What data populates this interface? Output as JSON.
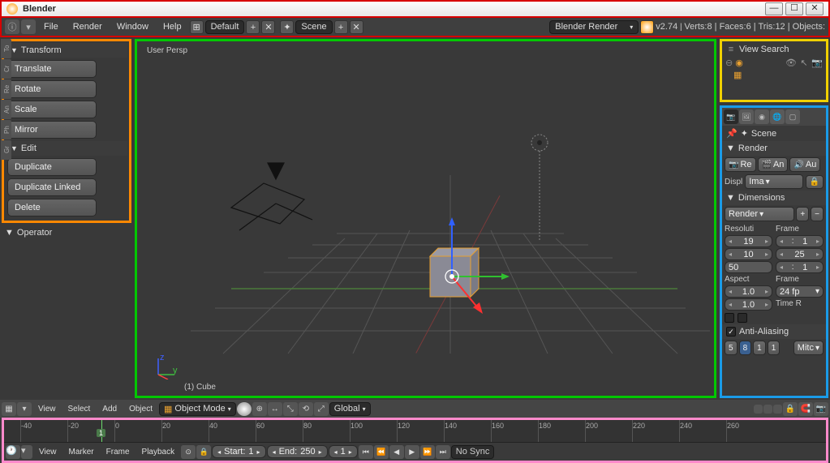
{
  "window": {
    "title": "Blender"
  },
  "topbar": {
    "menus": [
      "File",
      "Render",
      "Window",
      "Help"
    ],
    "layout": "Default",
    "scene": "Scene",
    "engine": "Blender Render",
    "version": "v2.74",
    "stats": "Verts:8 | Faces:6 | Tris:12 | Objects:"
  },
  "toolshelf": {
    "transform": {
      "title": "Transform",
      "ops": [
        "Translate",
        "Rotate",
        "Scale",
        "Mirror"
      ]
    },
    "edit": {
      "title": "Edit",
      "ops": [
        "Duplicate",
        "Duplicate Linked",
        "Delete"
      ]
    },
    "operator": "Operator"
  },
  "viewport": {
    "view_label": "User Persp",
    "object_label": "(1) Cube",
    "header": {
      "menus": [
        "View",
        "Select",
        "Add",
        "Object"
      ],
      "mode": "Object Mode",
      "orientation": "Global"
    }
  },
  "outliner": {
    "menus": [
      "View",
      "Search"
    ]
  },
  "props": {
    "scene_name": "Scene",
    "render": {
      "title": "Render",
      "buttons": [
        "Re",
        "An",
        "Au"
      ],
      "display_label": "Displ",
      "display": "Ima"
    },
    "dimensions": {
      "title": "Dimensions",
      "preset": "Render",
      "res_label": "Resoluti",
      "frame_label": "Frame",
      "res_x": "19",
      "res_y": "10",
      "res_pct": "50",
      "frame_start": "1",
      "frame_end": "25",
      "frame_step": "1",
      "aspect_label": "Aspect",
      "framerate_label": "Frame",
      "aspect_x": "1.0",
      "fps": "24 fp",
      "aspect_y": "1.0",
      "time_label": "Time R"
    },
    "aa": {
      "title": "Anti-Aliasing",
      "samples": [
        "5",
        "8",
        "1",
        "1"
      ],
      "filter": "Mitc"
    }
  },
  "timeline": {
    "ticks": [
      "-40",
      "-20",
      "0",
      "20",
      "40",
      "60",
      "80",
      "100",
      "120",
      "140",
      "160",
      "180",
      "200",
      "220",
      "240",
      "260"
    ],
    "current": "1",
    "menus": [
      "View",
      "Marker",
      "Frame",
      "Playback"
    ],
    "start_label": "Start:",
    "start": "1",
    "end_label": "End:",
    "end": "250",
    "frame": "1",
    "sync": "No Sync"
  }
}
